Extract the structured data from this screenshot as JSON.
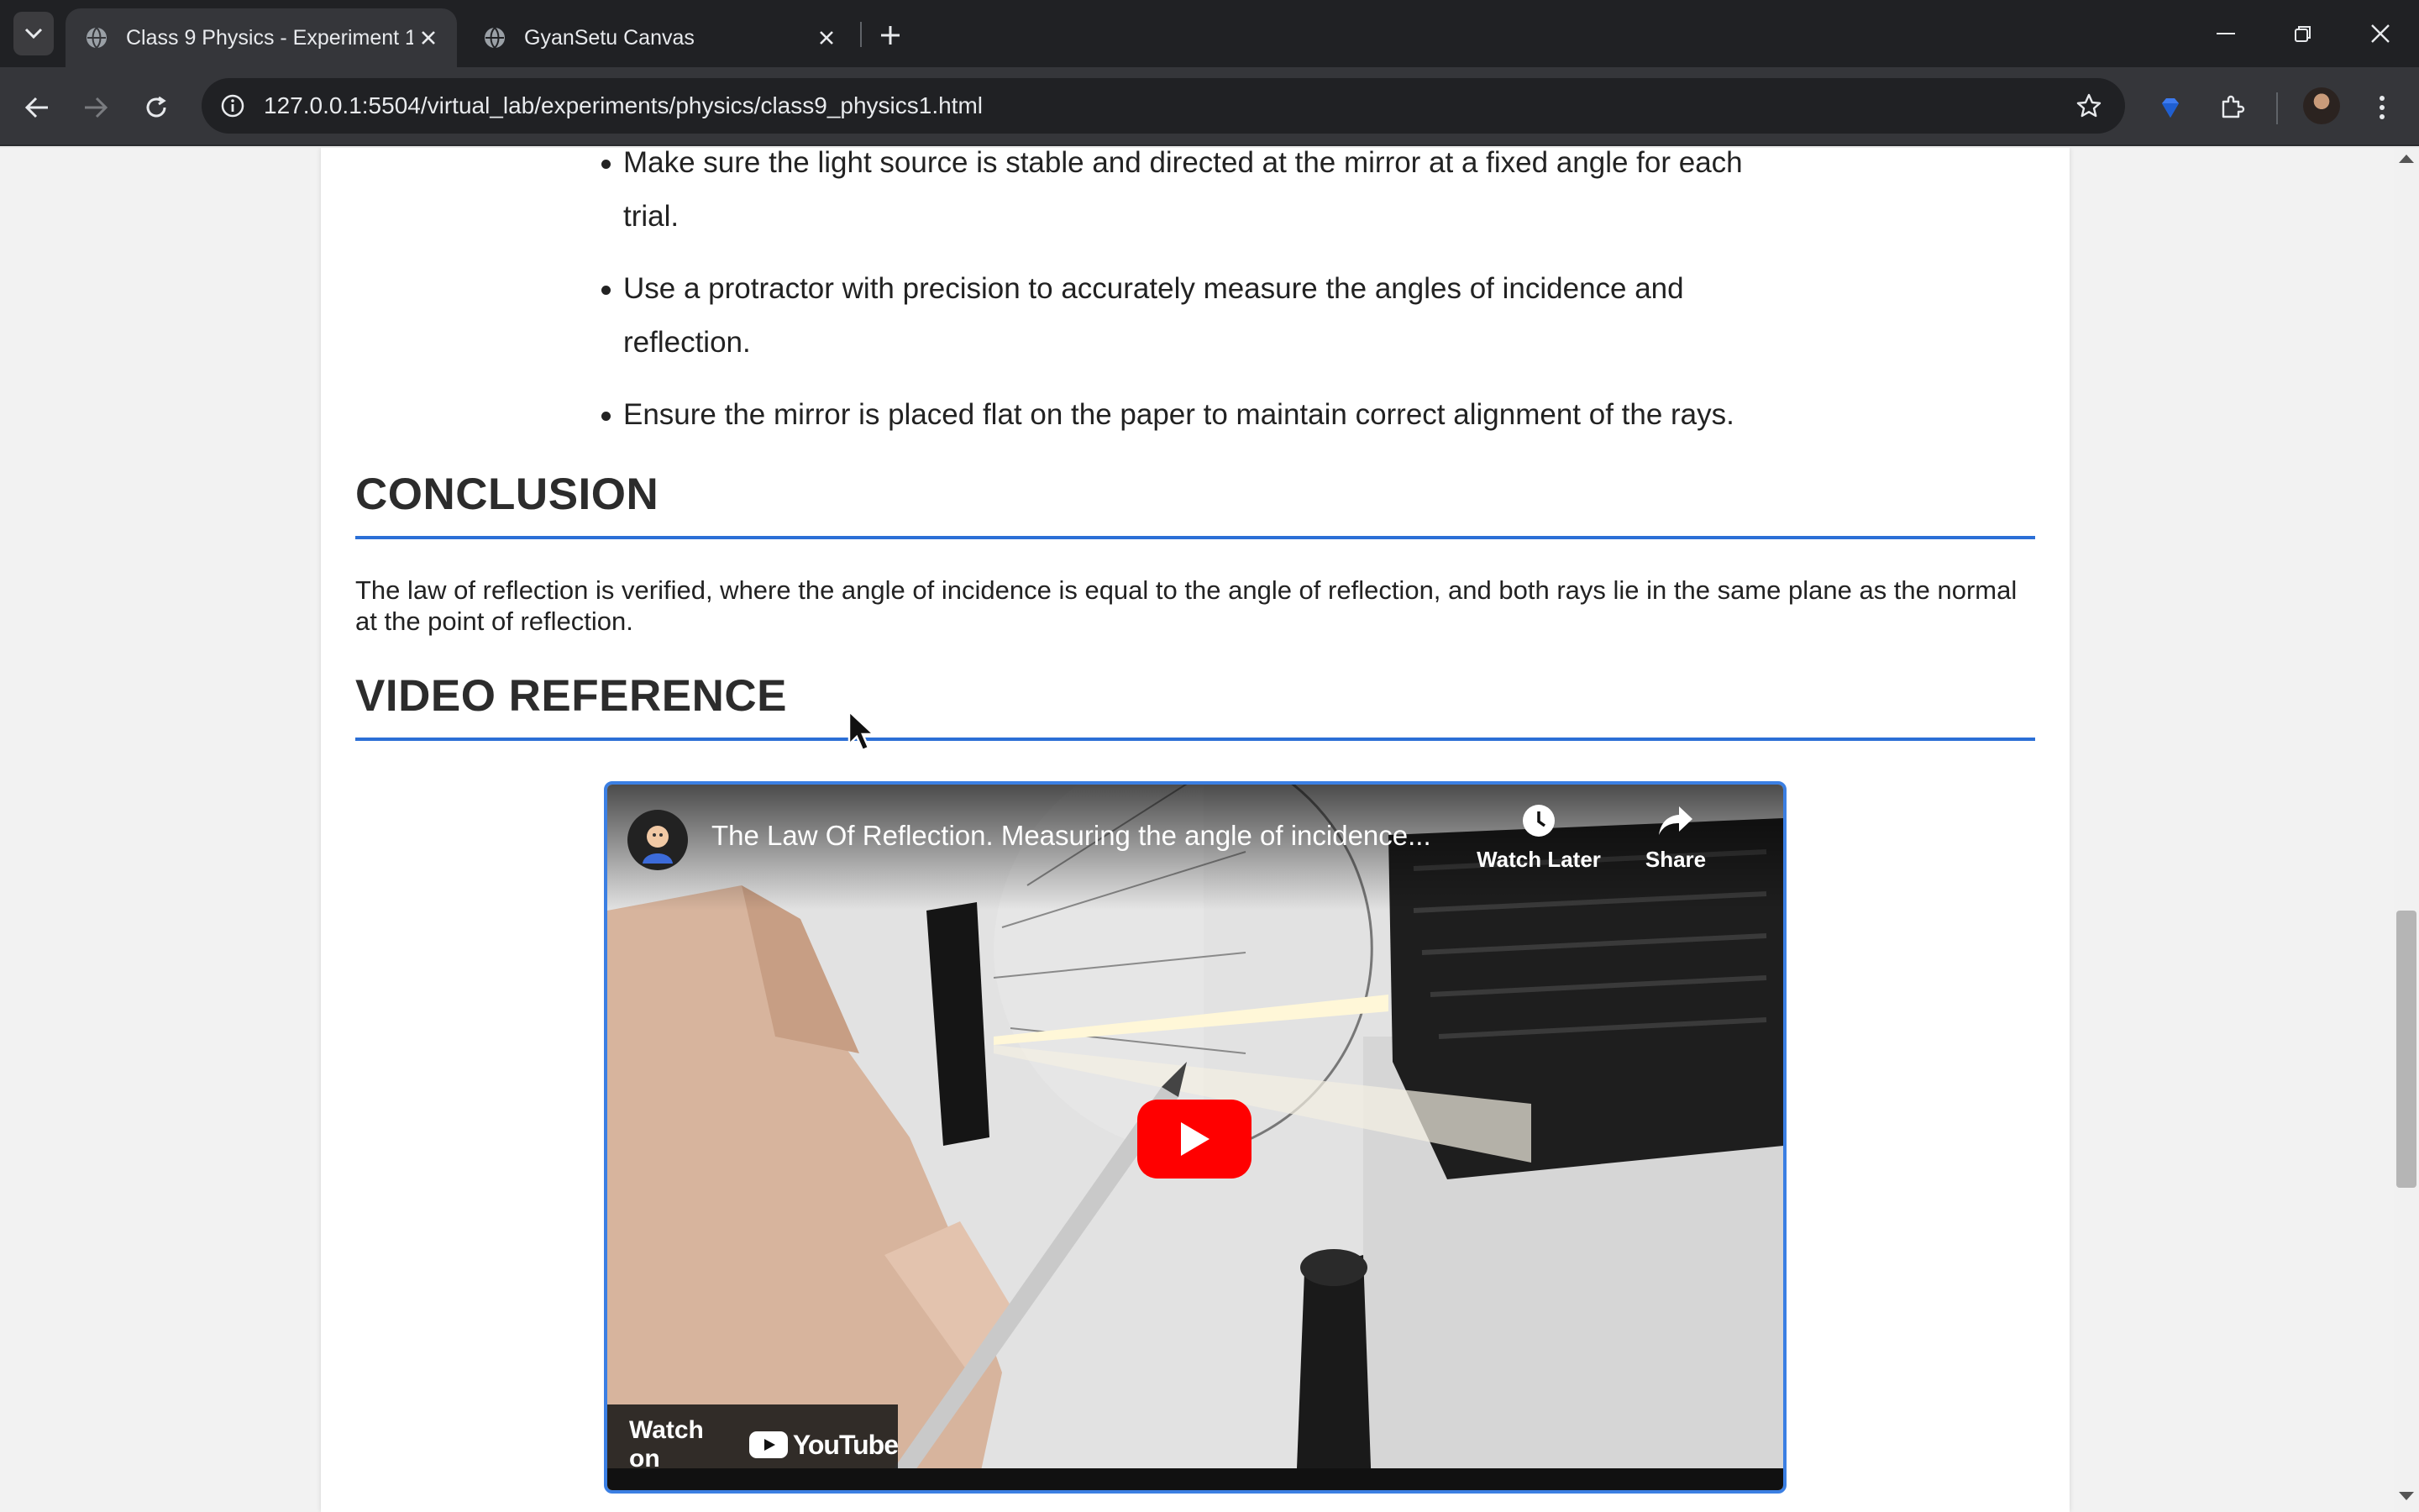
{
  "browser": {
    "tabs": [
      {
        "title": "Class 9 Physics - Experiment 1",
        "active": true
      },
      {
        "title": "GyanSetu Canvas",
        "active": false
      }
    ],
    "url": "127.0.0.1:5504/virtual_lab/experiments/physics/class9_physics1.html"
  },
  "page": {
    "precautions": [
      "Make sure the light source is stable and directed at the mirror at a fixed angle for each trial.",
      "Use a protractor with precision to accurately measure the angles of incidence and reflection.",
      "Ensure the mirror is placed flat on the paper to maintain correct alignment of the rays."
    ],
    "conclusion": {
      "heading": "CONCLUSION",
      "text": "The law of reflection is verified, where the angle of incidence is equal to the angle of reflection, and both rays lie in the same plane as the normal at the point of reflection."
    },
    "video_reference": {
      "heading": "VIDEO REFERENCE",
      "video_title": "The Law Of Reflection. Measuring the angle of incidence...",
      "watch_later_label": "Watch Later",
      "share_label": "Share",
      "watch_on_label": "Watch on",
      "youtube_label": "YouTube"
    }
  },
  "colors": {
    "accent": "#2b6fd6",
    "youtube_red": "#ff0000",
    "chrome_dark": "#202124"
  }
}
